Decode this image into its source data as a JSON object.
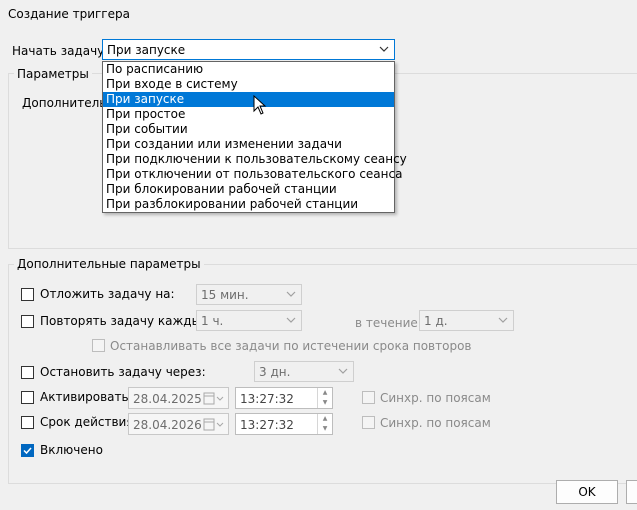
{
  "window": {
    "title": "Создание триггера"
  },
  "start": {
    "label": "Начать задачу:",
    "selected": "При запуске"
  },
  "dropdown": {
    "items": [
      "По расписанию",
      "При входе в систему",
      "При запуске",
      "При простое",
      "При событии",
      "При создании или изменении задачи",
      "При подключении к пользовательскому сеансу",
      "При отключении от пользовательского сеанса",
      "При блокировании рабочей станции",
      "При разблокировании рабочей станции"
    ],
    "selected_index": 2
  },
  "params": {
    "group_label": "Параметры",
    "truncated_label": "Дополнительн"
  },
  "advanced": {
    "group_label": "Дополнительные параметры",
    "delay": {
      "label": "Отложить задачу на:",
      "value": "15 мин."
    },
    "repeat": {
      "label": "Повторять задачу каждые:",
      "value": "1 ч.",
      "duration_label": "в течение:",
      "duration_value": "1 д."
    },
    "stop_all": {
      "label": "Останавливать все задачи по истечении срока повторов"
    },
    "stop_after": {
      "label": "Остановить задачу через:",
      "value": "3 дн."
    },
    "activate": {
      "label": "Активировать:",
      "date": "28.04.2025",
      "time": "13:27:32",
      "sync_label": "Синхр. по поясам"
    },
    "expire": {
      "label": "Срок действия:",
      "date": "28.04.2026",
      "time": "13:27:32",
      "sync_label": "Синхр. по поясам"
    },
    "enabled": {
      "label": "Включено",
      "checked": true
    }
  },
  "buttons": {
    "ok": "OK"
  },
  "colors": {
    "accent": "#0078d7",
    "check_on": "#0067c0"
  }
}
